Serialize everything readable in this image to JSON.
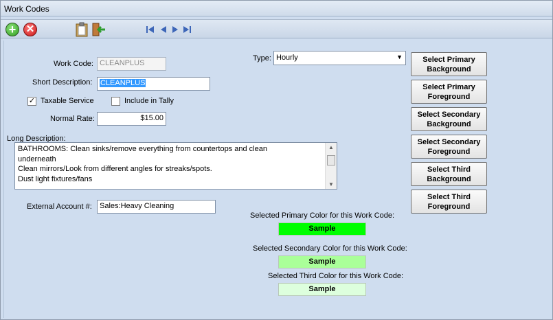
{
  "window": {
    "title": "Work Codes"
  },
  "toolbar": {
    "add_icon": "add-icon",
    "delete_icon": "delete-icon",
    "clipboard_icon": "clipboard-icon",
    "exit_icon": "exit-door-icon"
  },
  "form": {
    "work_code_label": "Work Code:",
    "work_code_value": "CLEANPLUS",
    "short_desc_label": "Short Description:",
    "short_desc_value": "CLEANPLUS",
    "taxable_label": "Taxable Service",
    "taxable_checked": true,
    "tally_label": "Include in Tally",
    "tally_checked": false,
    "normal_rate_label": "Normal Rate:",
    "normal_rate_value": "$15.00",
    "long_desc_label": "Long Description:",
    "long_desc_lines": [
      "BATHROOMS: Clean sinks/remove everything from countertops and clean",
      "underneath",
      "Clean mirrors/Look from different angles for streaks/spots.",
      "Dust light fixtures/fans"
    ],
    "external_account_label": "External Account #:",
    "external_account_value": "Sales:Heavy Cleaning",
    "type_label": "Type:",
    "type_value": "Hourly"
  },
  "buttons": {
    "primary_bg": "Select Primary\nBackground",
    "primary_fg": "Select Primary\nForeground",
    "secondary_bg": "Select Secondary\nBackground",
    "secondary_fg": "Select Secondary\nForeground",
    "third_bg": "Select Third\nBackground",
    "third_fg": "Select Third\nForeground"
  },
  "colors": {
    "primary_label": "Selected Primary Color for this Work Code:",
    "primary_sample": "Sample",
    "primary_color": "#00ff00",
    "secondary_label": "Selected Secondary Color for this Work Code:",
    "secondary_sample": "Sample",
    "secondary_color": "#aaff99",
    "third_label": "Selected Third Color for this Work Code:",
    "third_sample": "Sample",
    "third_color": "#ddffdd"
  }
}
